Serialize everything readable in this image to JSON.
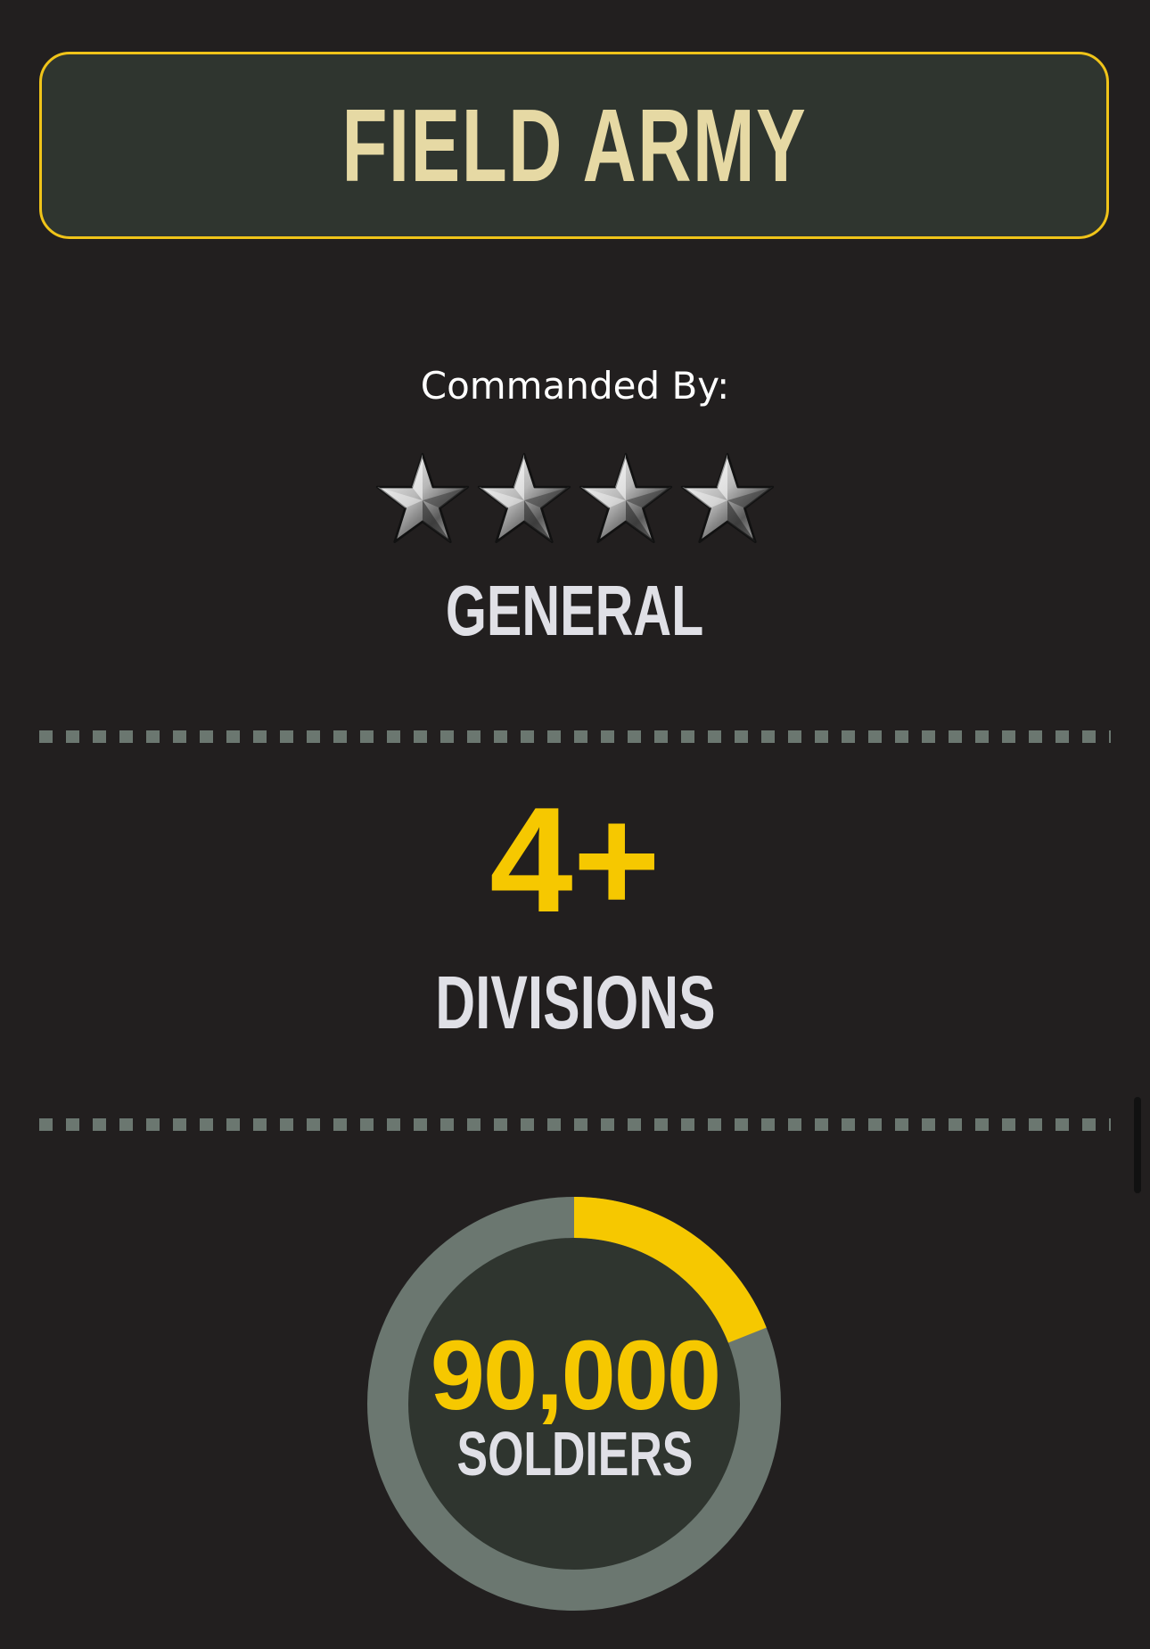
{
  "header": {
    "title": "FIELD ARMY"
  },
  "command": {
    "label": "Commanded By:",
    "star_count": 4,
    "star_icon": "star-insignia-icon",
    "rank": "GENERAL"
  },
  "divisions": {
    "value": "4+",
    "label": "DIVISIONS"
  },
  "soldiers": {
    "value": "90,000",
    "label": "SOLDIERS",
    "progress_fraction": 0.19
  },
  "colors": {
    "background": "#221f1f",
    "card": "#2f352f",
    "accent": "#f6c800",
    "title": "#e6d9a4",
    "ring_track": "#6b7770"
  }
}
